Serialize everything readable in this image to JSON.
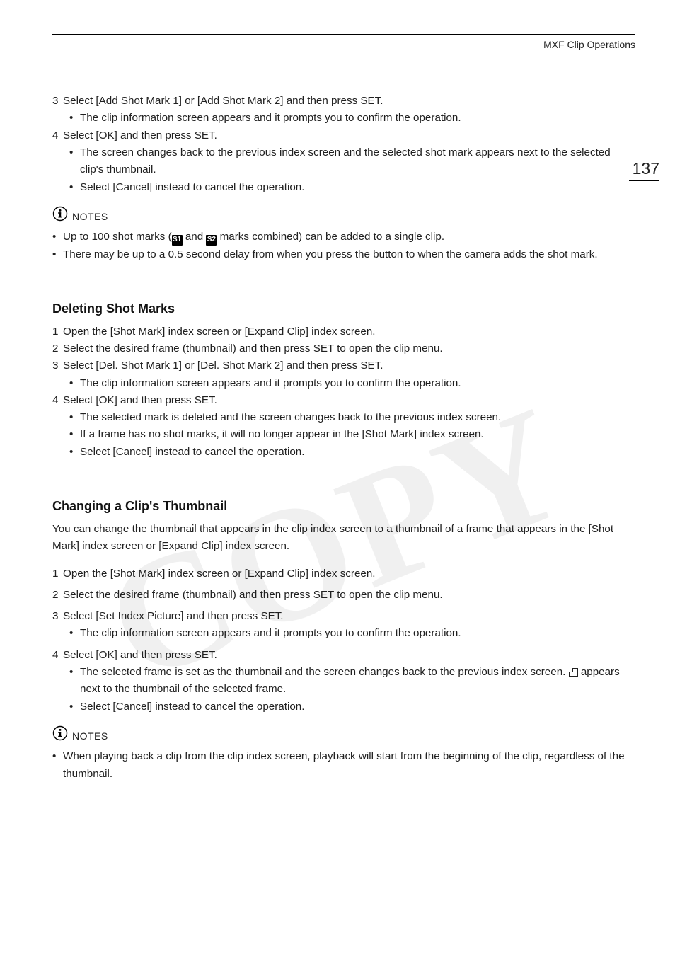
{
  "header": {
    "section_title": "MXF Clip Operations"
  },
  "page_number": "137",
  "watermark": "COPY",
  "section_a": {
    "steps": [
      {
        "num": "3",
        "text": "Select [Add Shot Mark 1] or [Add Shot Mark 2] and then press SET.",
        "bullets": [
          "The clip information screen appears and it prompts you to confirm the operation."
        ]
      },
      {
        "num": "4",
        "text": "Select [OK] and then press SET.",
        "bullets": [
          "The screen changes back to the previous index screen and the selected shot mark appears next to the selected clip's thumbnail.",
          "Select [Cancel] instead to cancel the operation."
        ]
      }
    ]
  },
  "notes1": {
    "label": "NOTES",
    "items_a": "Up to 100 shot marks (",
    "mark1": "S1",
    "items_a_mid": " and ",
    "mark2": "S2",
    "items_a_end": " marks combined) can be added to a single clip.",
    "items_b": "There may be up to a 0.5 second delay from when you press the button to when the camera adds the shot mark."
  },
  "section_b": {
    "heading": "Deleting Shot Marks",
    "steps": [
      {
        "num": "1",
        "text": "Open the [Shot Mark] index screen or [Expand Clip] index screen.",
        "bullets": []
      },
      {
        "num": "2",
        "text": "Select the desired frame (thumbnail) and then press SET to open the clip menu.",
        "bullets": []
      },
      {
        "num": "3",
        "text": "Select [Del. Shot Mark 1] or [Del. Shot Mark 2] and then press SET.",
        "bullets": [
          "The clip information screen appears and it prompts you to confirm the operation."
        ]
      },
      {
        "num": "4",
        "text": "Select [OK] and then press SET.",
        "bullets": [
          "The selected mark is deleted and the screen changes back to the previous index screen.",
          "If a frame has no shot marks, it will no longer appear in the [Shot Mark] index screen.",
          "Select [Cancel] instead to cancel the operation."
        ]
      }
    ]
  },
  "section_c": {
    "heading": "Changing a Clip's Thumbnail",
    "intro": "You can change the thumbnail that appears in the clip index screen to a thumbnail of a frame that appears in the [Shot Mark] index screen or [Expand Clip] index screen.",
    "steps": [
      {
        "num": "1",
        "text": "Open the [Shot Mark] index screen or [Expand Clip] index screen.",
        "bullets": []
      },
      {
        "num": "2",
        "text": "Select the desired frame (thumbnail) and then press SET to open the clip menu.",
        "bullets": []
      },
      {
        "num": "3",
        "text": "Select [Set Index Picture] and then press SET.",
        "bullets": [
          "The clip information screen appears and it prompts you to confirm the operation."
        ]
      },
      {
        "num": "4",
        "text": "Select [OK] and then press SET.",
        "special_bullet_pre": "The selected frame is set as the thumbnail and the screen changes back to the previous index screen. ",
        "special_bullet_post": " appears next to the thumbnail of the selected frame.",
        "bullets_after": [
          "Select [Cancel] instead to cancel the operation."
        ]
      }
    ]
  },
  "notes2": {
    "label": "NOTES",
    "items": [
      "When playing back a clip from the clip index screen, playback will start from the beginning of the clip, regardless of the thumbnail."
    ]
  }
}
